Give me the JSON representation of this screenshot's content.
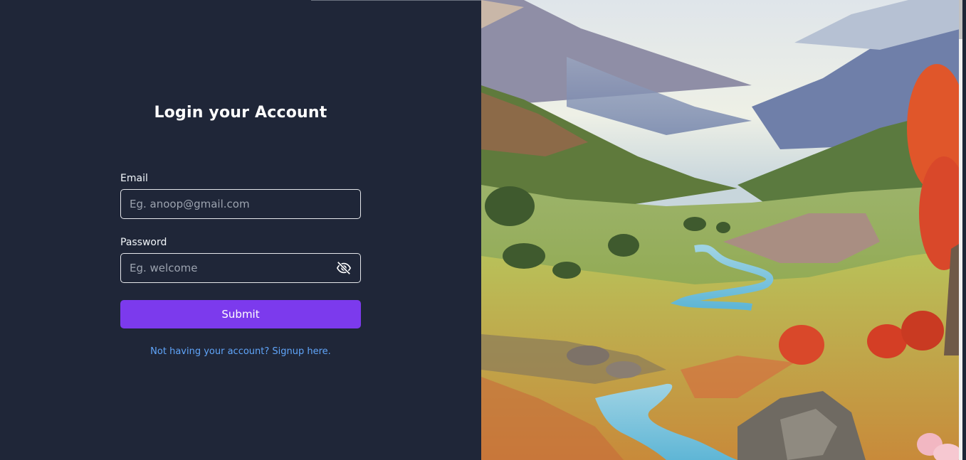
{
  "page": {
    "title": "Login your Account"
  },
  "form": {
    "email_label": "Email",
    "email_placeholder": "Eg. anoop@gmail.com",
    "email_value": "",
    "password_label": "Password",
    "password_placeholder": "Eg. welcome",
    "password_value": "",
    "submit_label": "Submit",
    "signup_link": "Not having your account? Signup here.",
    "password_toggle_icon": "eye-off-icon"
  },
  "colors": {
    "background": "#1f2638",
    "accent": "#7c3aed",
    "link": "#60a5fa"
  },
  "image": {
    "description_icon": "landscape-illustration"
  }
}
